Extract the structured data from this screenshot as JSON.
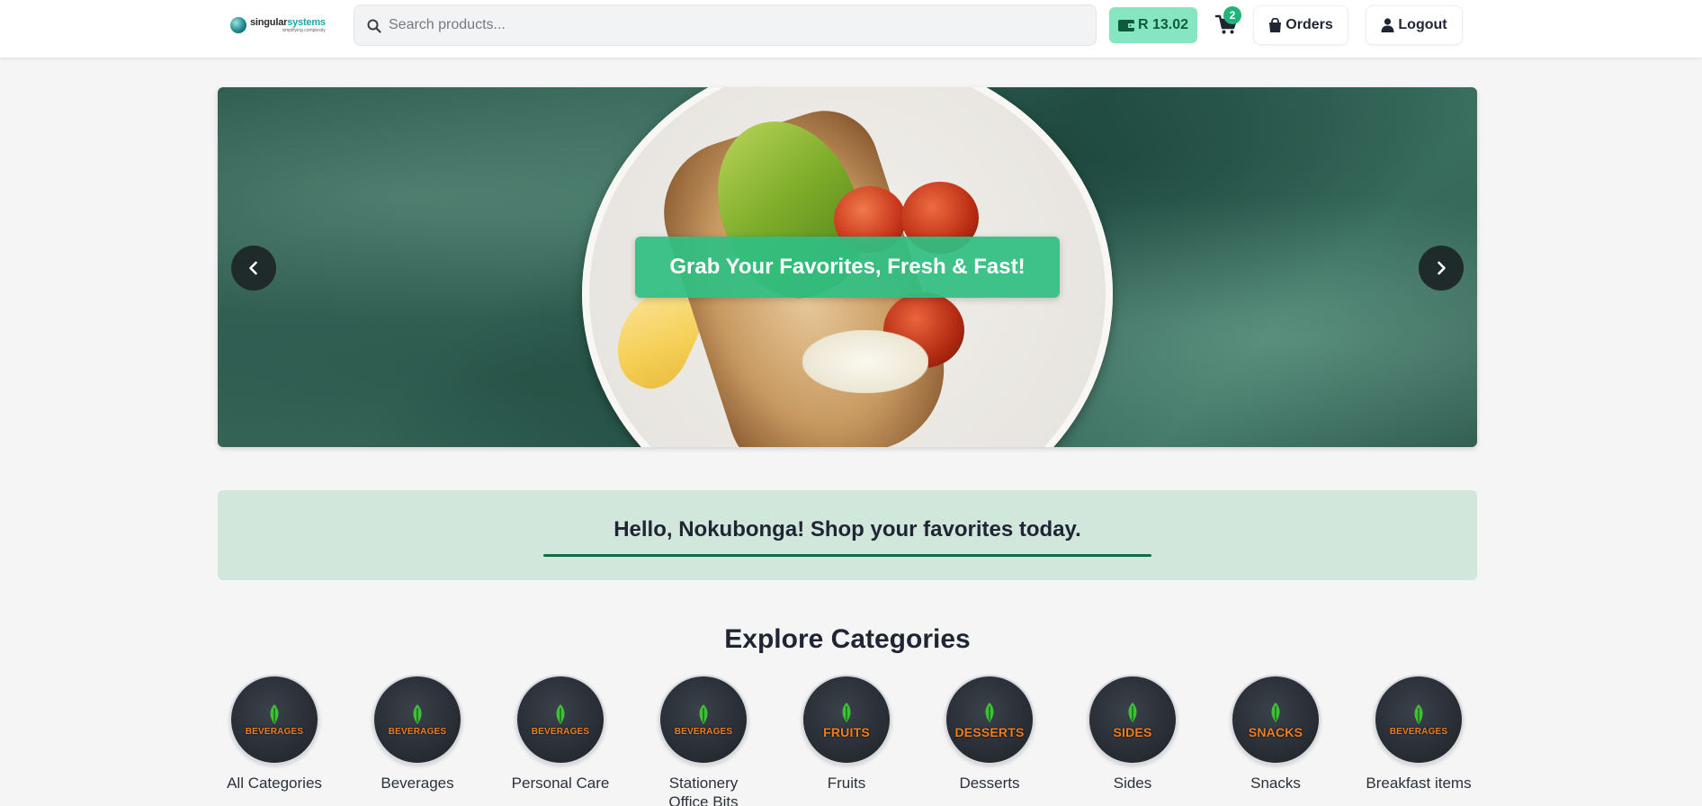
{
  "header": {
    "logo": {
      "main": "singular",
      "accent": "systems",
      "tagline": "simplifying complexity"
    },
    "search": {
      "placeholder": "Search products...",
      "value": ""
    },
    "wallet": {
      "amount": "R 13.02"
    },
    "cart": {
      "count": "2"
    },
    "orders_label": "Orders",
    "logout_label": "Logout"
  },
  "hero": {
    "caption": "Grab Your Favorites, Fresh & Fast!",
    "prev_label": "previous",
    "next_label": "next"
  },
  "greeting": {
    "text": "Hello, Nokubonga! Shop your favorites today."
  },
  "categories": {
    "title": "Explore Categories",
    "items": [
      {
        "label": "All Categories",
        "badge": "BEVERAGES"
      },
      {
        "label": "Beverages",
        "badge": "BEVERAGES"
      },
      {
        "label": "Personal Care",
        "badge": "BEVERAGES"
      },
      {
        "label": "Stationery Office Bits",
        "badge": "BEVERAGES"
      },
      {
        "label": "Fruits",
        "badge": "FRUITS"
      },
      {
        "label": "Desserts",
        "badge": "DESSERTS"
      },
      {
        "label": "Sides",
        "badge": "SIDES"
      },
      {
        "label": "Snacks",
        "badge": "SNACKS"
      },
      {
        "label": "Breakfast items",
        "badge": "BEVERAGES"
      }
    ]
  },
  "colors": {
    "accent_green": "#22b37a",
    "wallet_bg": "#86e6c2",
    "greeting_bg": "#d2e7dc",
    "greeting_underline": "#0e6e44",
    "category_text": "#f07e1e"
  },
  "icons": {
    "search": "search-icon",
    "wallet": "wallet-icon",
    "cart": "cart-icon",
    "orders": "shopping-bag-icon",
    "logout": "user-icon",
    "prev": "chevron-left-icon",
    "next": "chevron-right-icon"
  }
}
